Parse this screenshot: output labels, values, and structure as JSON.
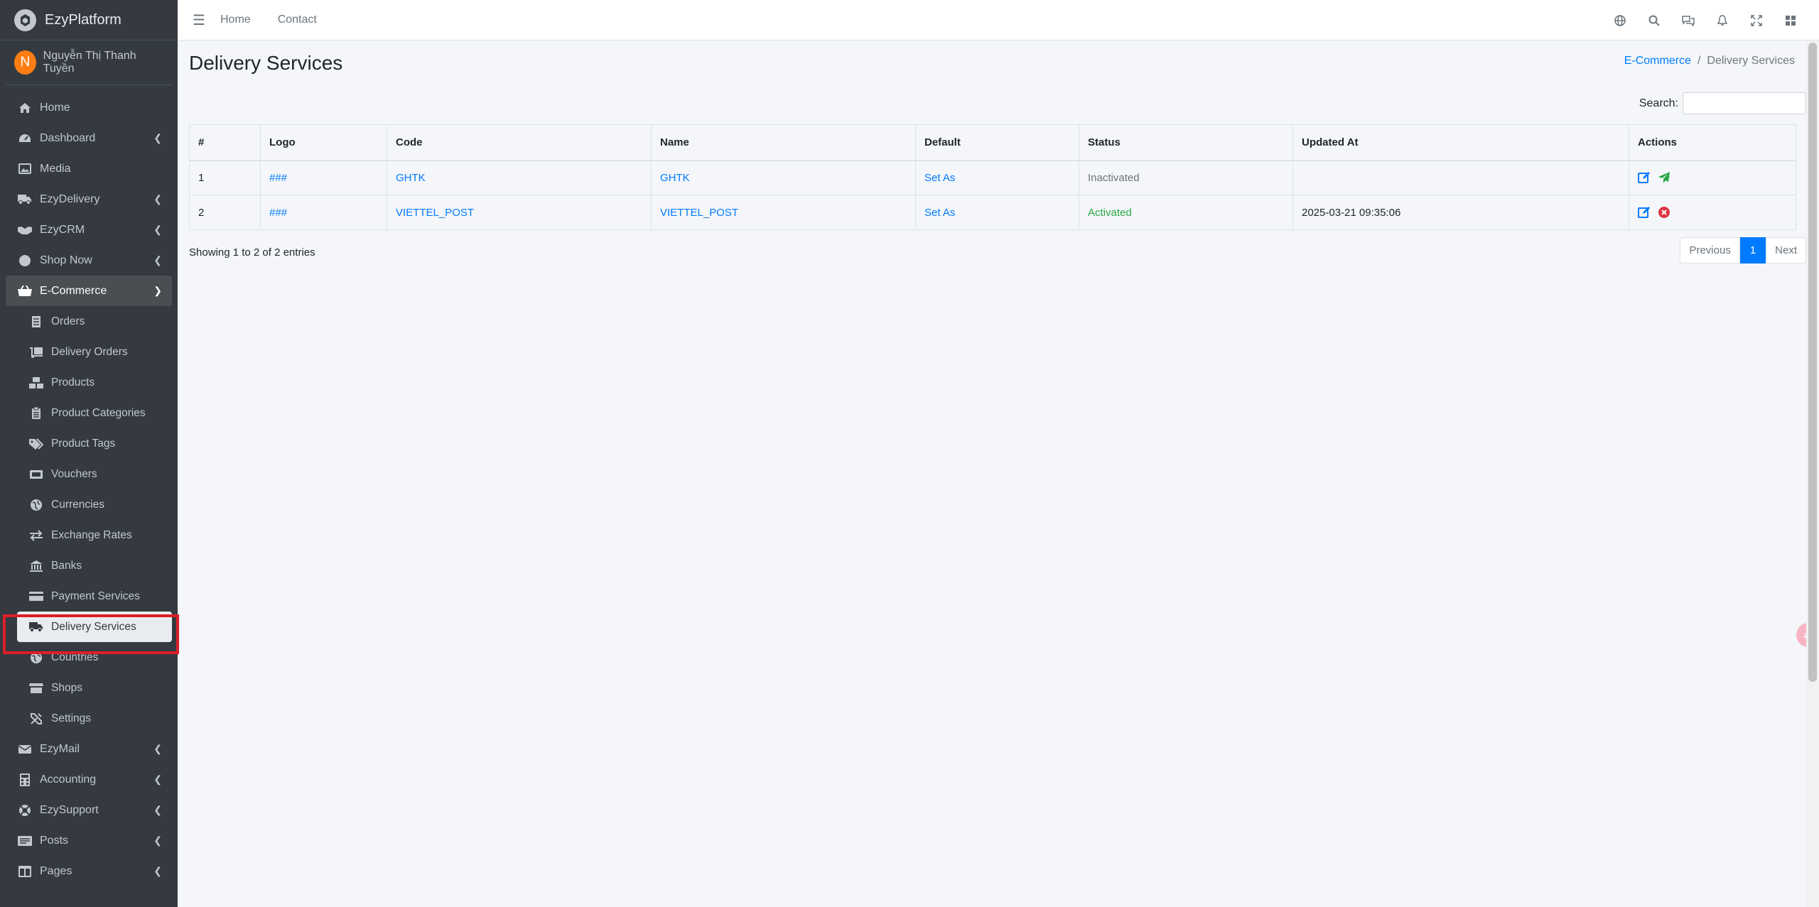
{
  "brand": {
    "name": "EzyPlatform"
  },
  "user": {
    "initial": "N",
    "name": "Nguyễn Thị Thanh Tuyền"
  },
  "sidebar": {
    "items": [
      {
        "label": "Home"
      },
      {
        "label": "Dashboard"
      },
      {
        "label": "Media"
      },
      {
        "label": "EzyDelivery"
      },
      {
        "label": "EzyCRM"
      },
      {
        "label": "Shop Now"
      },
      {
        "label": "E-Commerce"
      }
    ],
    "ecommerce_sub": [
      {
        "label": "Orders"
      },
      {
        "label": "Delivery Orders"
      },
      {
        "label": "Products"
      },
      {
        "label": "Product Categories"
      },
      {
        "label": "Product Tags"
      },
      {
        "label": "Vouchers"
      },
      {
        "label": "Currencies"
      },
      {
        "label": "Exchange Rates"
      },
      {
        "label": "Banks"
      },
      {
        "label": "Payment Services"
      },
      {
        "label": "Delivery Services"
      },
      {
        "label": "Countries"
      },
      {
        "label": "Shops"
      },
      {
        "label": "Settings"
      }
    ],
    "bottom_items": [
      {
        "label": "EzyMail"
      },
      {
        "label": "Accounting"
      },
      {
        "label": "EzySupport"
      },
      {
        "label": "Posts"
      },
      {
        "label": "Pages"
      }
    ]
  },
  "topnav": {
    "home": "Home",
    "contact": "Contact"
  },
  "page": {
    "title": "Delivery Services"
  },
  "breadcrumb": {
    "parent": "E-Commerce",
    "separator": "/",
    "current": "Delivery Services"
  },
  "search": {
    "label": "Search:",
    "value": ""
  },
  "table": {
    "headers": [
      "#",
      "Logo",
      "Code",
      "Name",
      "Default",
      "Status",
      "Updated At",
      "Actions"
    ],
    "rows": [
      {
        "num": "1",
        "logo": "###",
        "code": "GHTK",
        "name": "GHTK",
        "default": "Set As",
        "status": "Inactivated",
        "updated_at": ""
      },
      {
        "num": "2",
        "logo": "###",
        "code": "VIETTEL_POST",
        "name": "VIETTEL_POST",
        "default": "Set As",
        "status": "Activated",
        "updated_at": "2025-03-21 09:35:06"
      }
    ]
  },
  "info": "Showing 1 to 2 of 2 entries",
  "pager": {
    "prev": "Previous",
    "current": "1",
    "next": "Next"
  },
  "colors": {
    "sidebar_bg": "#343a40",
    "link": "#007bff",
    "active_status": "#28a745",
    "highlight": "#dc1f26"
  }
}
